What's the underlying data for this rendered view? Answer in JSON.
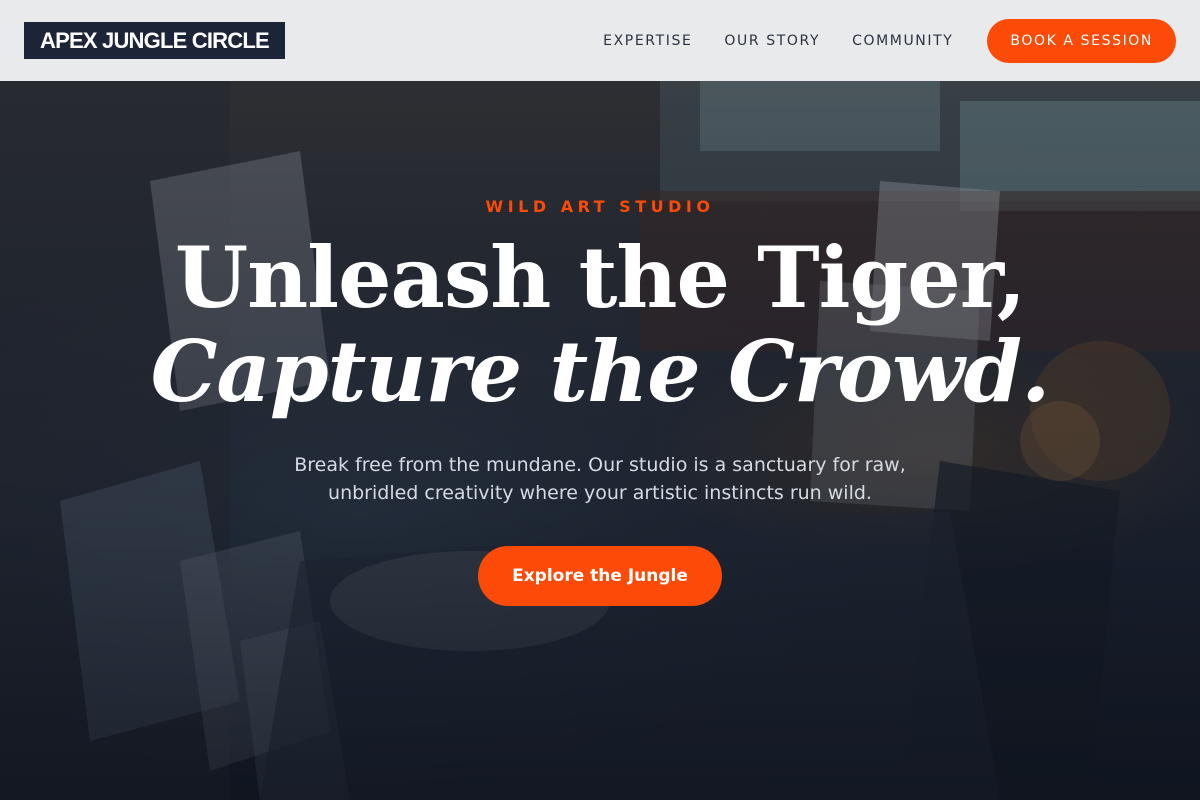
{
  "header": {
    "logo": "APEX JUNGLE CIRCLE",
    "nav": [
      {
        "label": "EXPERTISE"
      },
      {
        "label": "OUR STORY"
      },
      {
        "label": "COMMUNITY"
      }
    ],
    "cta_label": "BOOK A SESSION"
  },
  "hero": {
    "eyebrow": "WILD ART STUDIO",
    "headline_line1": "Unleash the Tiger,",
    "headline_line2": "Capture the Crowd.",
    "subtext": "Break free from the mundane. Our studio is a sanctuary for raw, unbridled creativity where your artistic instincts run wild.",
    "cta_label": "Explore the Jungle"
  },
  "colors": {
    "accent": "#fc4a08",
    "logo_bg": "#1c2537",
    "header_bg": "#e9eaec"
  }
}
